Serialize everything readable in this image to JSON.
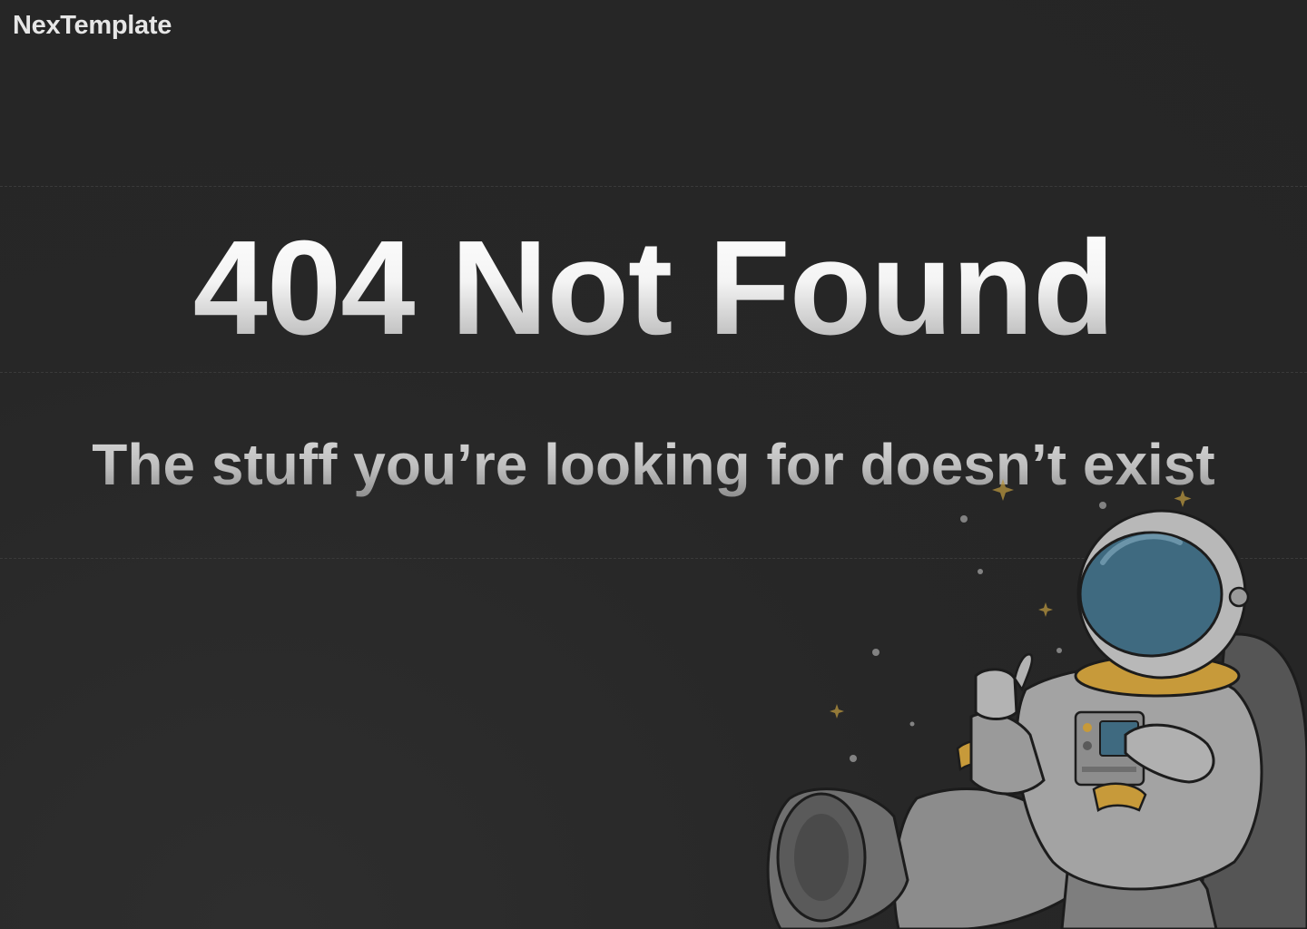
{
  "brand": {
    "name": "NexTemplate"
  },
  "error": {
    "title": "404 Not Found",
    "message": "The stuff you’re looking for doesn’t exist"
  },
  "illustration": {
    "icon": "astronaut-illustration"
  },
  "colors": {
    "background": "#262626",
    "text_light": "#ffffff",
    "text_muted": "#bdbdbd",
    "visor": "#3f6a80",
    "gold": "#c79a3a",
    "suit": "#9a9a9a"
  }
}
